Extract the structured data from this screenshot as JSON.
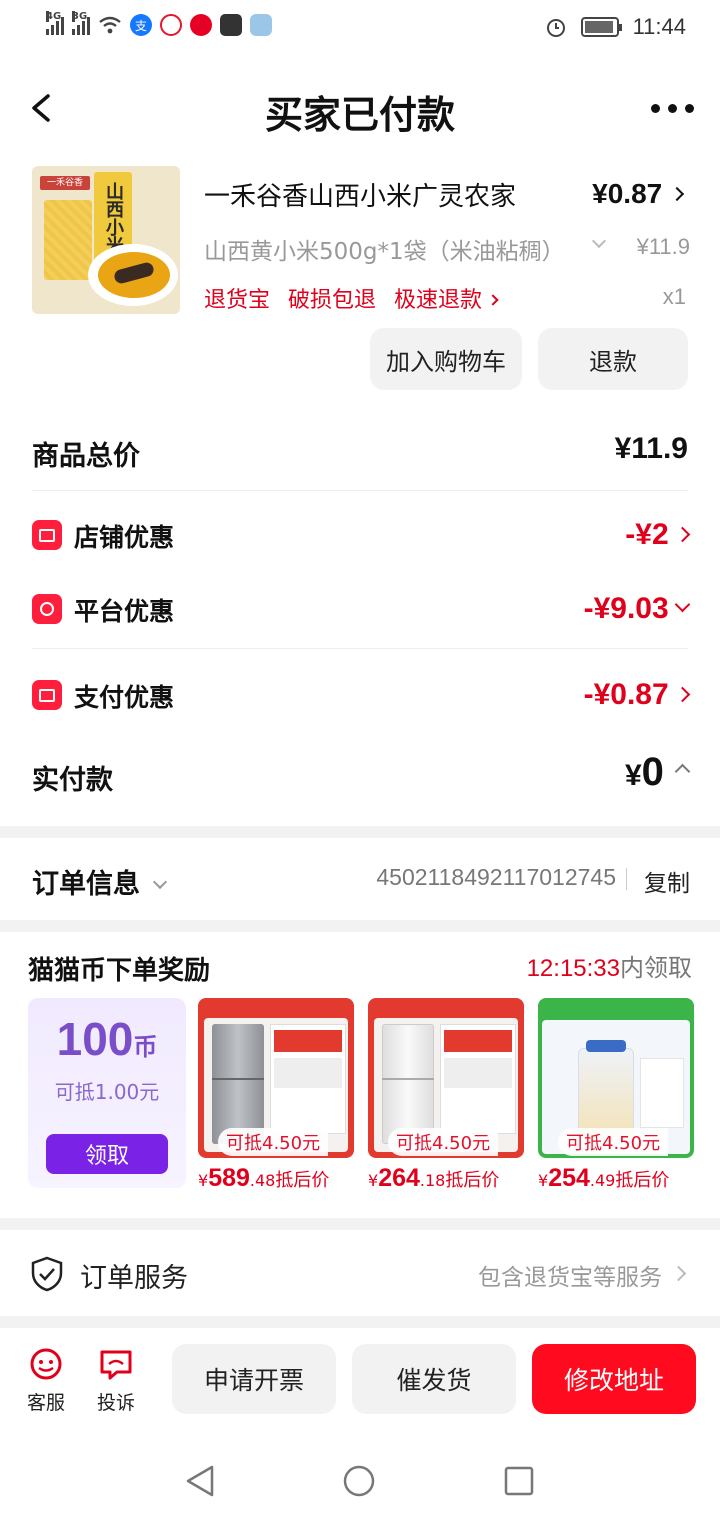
{
  "status_bar": {
    "signal1": "4G",
    "signal2": "3G",
    "alipay_glyph": "支",
    "time": "11:44",
    "icons": [
      "wifi-icon",
      "alipay-icon",
      "weibo-icon",
      "netease-music-icon",
      "app-icon",
      "cloud-icon",
      "alarm-icon",
      "battery-icon"
    ]
  },
  "header": {
    "title": "买家已付款"
  },
  "product": {
    "name": "一禾谷香山西小米广灵农家",
    "price": "¥0.87",
    "sku": "山西黄小米500g*1袋（米油粘稠）",
    "original_price": "¥11.9",
    "tags": [
      "退货宝",
      "破损包退",
      "极速退款"
    ],
    "quantity": "x1",
    "image_text": "山西小米",
    "image_brand": "一禾谷香",
    "add_cart_label": "加入购物车",
    "refund_label": "退款"
  },
  "price_summary": {
    "total_label": "商品总价",
    "total_value": "¥11.9",
    "shop_discount_label": "店铺优惠",
    "shop_discount_value": "-¥2",
    "platform_discount_label": "平台优惠",
    "platform_discount_value": "-¥9.03",
    "pay_discount_label": "支付优惠",
    "pay_discount_value": "-¥0.87",
    "paid_label": "实付款",
    "paid_currency": "¥",
    "paid_value": "0"
  },
  "order_info": {
    "label": "订单信息",
    "order_no": "4502118492117012745",
    "copy_label": "复制"
  },
  "rewards": {
    "title": "猫猫币下单奖励",
    "countdown": "12:15:33",
    "countdown_suffix": "内领取",
    "coin_amount": "100",
    "coin_unit": "币",
    "coin_offset": "可抵1.00元",
    "claim_label": "领取",
    "items": [
      {
        "badge": "可抵4.50元",
        "price_int": "589",
        "price_dec": ".48",
        "suffix": "抵后价",
        "color": "#e23a2e"
      },
      {
        "badge": "可抵4.50元",
        "price_int": "264",
        "price_dec": ".18",
        "suffix": "抵后价",
        "color": "#e23a2e"
      },
      {
        "badge": "可抵4.50元",
        "price_int": "254",
        "price_dec": ".49",
        "suffix": "抵后价",
        "color": "#3bb54a"
      }
    ],
    "price_currency": "¥"
  },
  "service": {
    "label": "订单服务",
    "desc": "包含退货宝等服务"
  },
  "bottom_bar": {
    "customer_service_label": "客服",
    "complaint_label": "投诉",
    "invoice_label": "申请开票",
    "urge_label": "催发货",
    "modify_address_label": "修改地址"
  },
  "colors": {
    "accent_red": "#e0001c",
    "badge_red": "#ff1e3c",
    "primary_button": "#ff0a1e",
    "claim_purple": "#7a22e6"
  }
}
